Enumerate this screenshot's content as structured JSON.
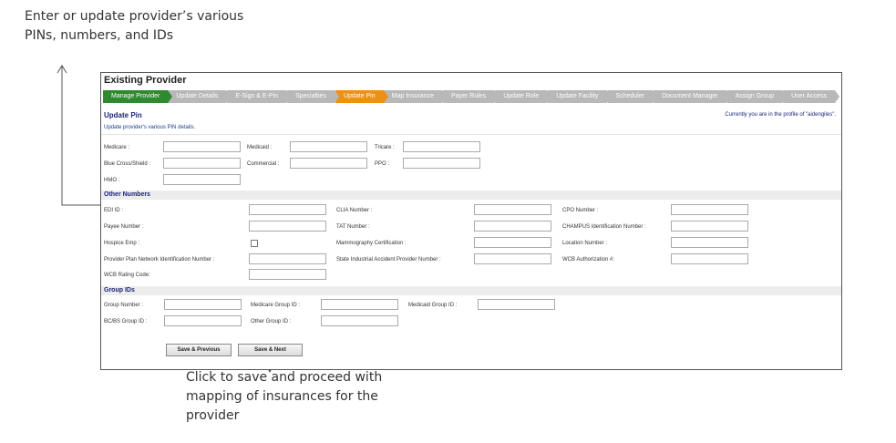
{
  "annotations": {
    "top_note": "Enter or update provider’s various PINs, numbers, and IDs",
    "bottom_note": "Click to save and proceed with mapping of insurances for the provider"
  },
  "page": {
    "title": "Existing Provider",
    "heading": "Update Pin",
    "subheading": "Update provider's various PIN details.",
    "profile_note": "Currently you are in the profile of \"aidengiles\"."
  },
  "tabs": [
    {
      "label": "Manage Provider",
      "state": "done"
    },
    {
      "label": "Update Details",
      "state": "normal"
    },
    {
      "label": "E-Sign & E-Pin",
      "state": "normal"
    },
    {
      "label": "Specialties",
      "state": "normal"
    },
    {
      "label": "Update Pin",
      "state": "active"
    },
    {
      "label": "Map Insurance",
      "state": "normal"
    },
    {
      "label": "Payer Rules",
      "state": "normal"
    },
    {
      "label": "Update Role",
      "state": "normal"
    },
    {
      "label": "Update Facility",
      "state": "normal"
    },
    {
      "label": "Scheduler",
      "state": "normal"
    },
    {
      "label": "Document Manager",
      "state": "normal"
    },
    {
      "label": "Assign Group",
      "state": "normal"
    },
    {
      "label": "User Access",
      "state": "normal"
    }
  ],
  "pins": {
    "medicare": {
      "label": "Medicare :",
      "value": ""
    },
    "medicaid": {
      "label": "Medicaid :",
      "value": ""
    },
    "tricare": {
      "label": "Tricare :",
      "value": ""
    },
    "blue_cross": {
      "label": "Blue Cross/Shield :",
      "value": ""
    },
    "commercial": {
      "label": "Commercial :",
      "value": ""
    },
    "ppo": {
      "label": "PPO :",
      "value": ""
    },
    "hmo": {
      "label": "HMO :",
      "value": ""
    }
  },
  "other_numbers": {
    "title": "Other Numbers",
    "edi_id": {
      "label": "EDI ID :",
      "value": ""
    },
    "clia": {
      "label": "CLIA Number :",
      "value": ""
    },
    "cpo": {
      "label": "CPO Number :",
      "value": ""
    },
    "payee": {
      "label": "Payee Number :",
      "value": ""
    },
    "tat": {
      "label": "TAT Number :",
      "value": ""
    },
    "champus": {
      "label": "CHAMPUS Identification Number :",
      "value": ""
    },
    "hospice": {
      "label": "Hospice Emp :",
      "checked": false
    },
    "mammography": {
      "label": "Mammography Certification :",
      "value": ""
    },
    "location": {
      "label": "Location Number :",
      "value": ""
    },
    "ppn": {
      "label": "Provider Plan Network Identification Number :",
      "value": ""
    },
    "siap": {
      "label": "State Industrial Accident Provider Number :",
      "value": ""
    },
    "wcb_auth": {
      "label": "WCB Authorization #:",
      "value": ""
    },
    "wcb_rating": {
      "label": "WCB Rating Code:",
      "value": ""
    }
  },
  "group_ids": {
    "title": "Group IDs",
    "group_number": {
      "label": "Group Number :",
      "value": ""
    },
    "medicare_group": {
      "label": "Medicare Group ID :",
      "value": ""
    },
    "medicaid_group": {
      "label": "Medicaid Group ID :",
      "value": ""
    },
    "bcbs_group": {
      "label": "BC/BS Group ID :",
      "value": ""
    },
    "other_group": {
      "label": "Other Group ID :",
      "value": ""
    }
  },
  "buttons": {
    "save_previous": "Save & Previous",
    "save_next": "Save & Next"
  },
  "colors": {
    "tab_done": "#2f8a2f",
    "tab_active": "#f09010",
    "tab_normal": "#b8b8b8",
    "heading": "#1a237e"
  }
}
